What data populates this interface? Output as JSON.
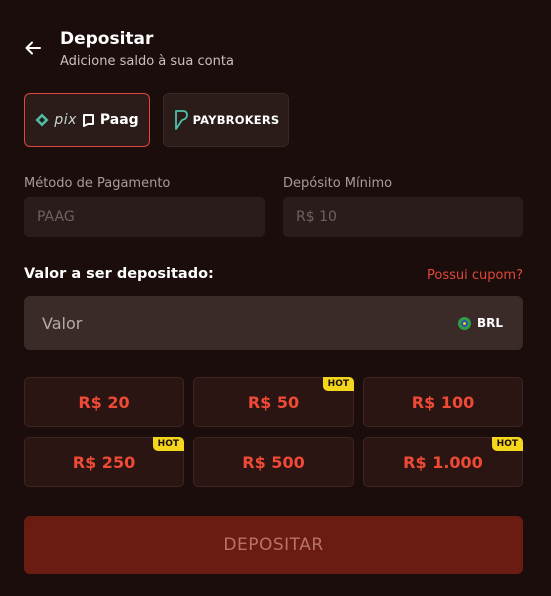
{
  "header": {
    "title": "Depositar",
    "subtitle": "Adicione saldo à sua conta"
  },
  "providers": [
    {
      "name": "pix Paag",
      "pix": "pix",
      "brand": "Paag",
      "active": true
    },
    {
      "name": "PAYBROKERS",
      "brand": "PAYBROKERS",
      "active": false
    }
  ],
  "fields": {
    "method_label": "Método de Pagamento",
    "method_value": "PAAG",
    "min_label": "Depósito Mínimo",
    "min_value": "R$ 10"
  },
  "amount": {
    "label": "Valor a ser depositado:",
    "coupon_link": "Possui cupom?",
    "placeholder": "Valor",
    "currency": "BRL"
  },
  "presets": [
    {
      "label": "R$ 20",
      "hot": false
    },
    {
      "label": "R$ 50",
      "hot": true
    },
    {
      "label": "R$ 100",
      "hot": false
    },
    {
      "label": "R$ 250",
      "hot": true
    },
    {
      "label": "R$ 500",
      "hot": false
    },
    {
      "label": "R$ 1.000",
      "hot": true
    }
  ],
  "hot_label": "HOT",
  "deposit_button": "DEPOSITAR",
  "colors": {
    "background": "#1b0d0b",
    "accent": "#e0473a",
    "preset_text": "#ef4a36",
    "hot_badge": "#f4d71c",
    "button": "#6a1c13"
  }
}
